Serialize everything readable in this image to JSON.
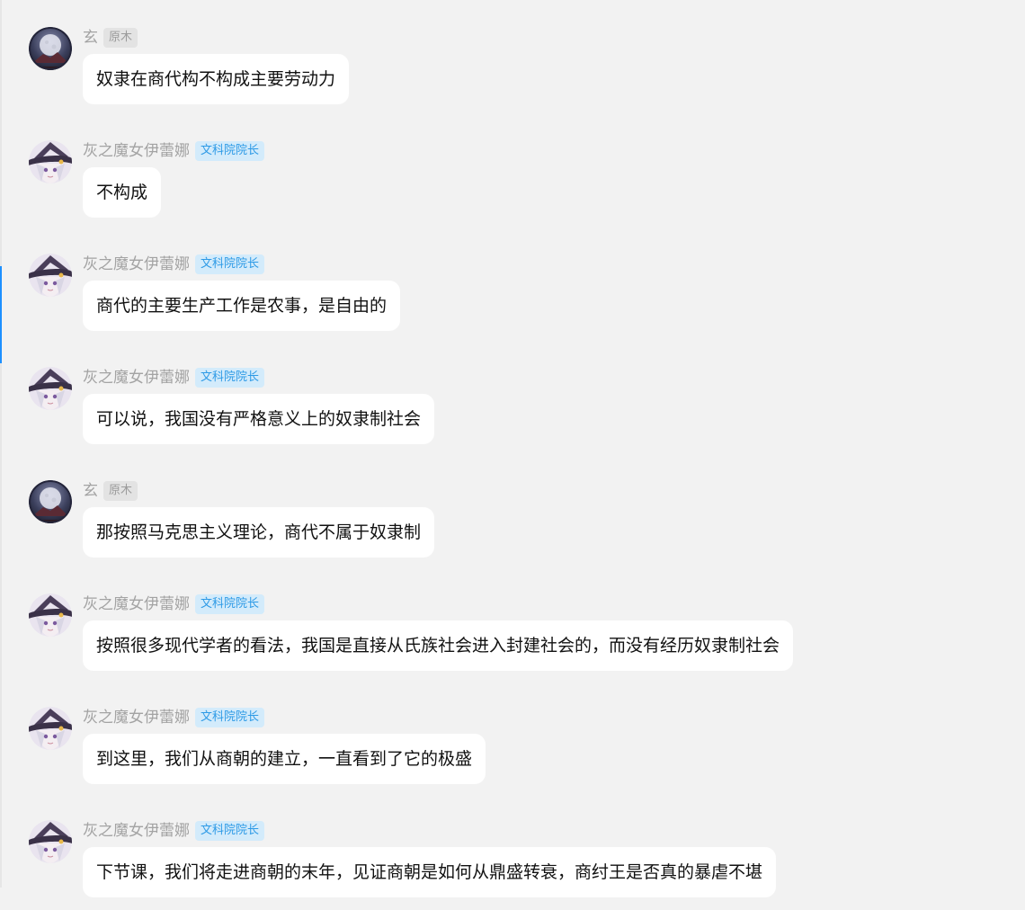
{
  "messages": [
    {
      "sender": "玄",
      "badge": "原木",
      "badge_style": "grey",
      "avatar": "xuan-avatar",
      "text": "奴隶在商代构不构成主要劳动力"
    },
    {
      "sender": "灰之魔女伊蕾娜",
      "badge": "文科院院长",
      "badge_style": "blue",
      "avatar": "elaina-avatar",
      "text": "不构成"
    },
    {
      "sender": "灰之魔女伊蕾娜",
      "badge": "文科院院长",
      "badge_style": "blue",
      "avatar": "elaina-avatar",
      "text": "商代的主要生产工作是农事，是自由的"
    },
    {
      "sender": "灰之魔女伊蕾娜",
      "badge": "文科院院长",
      "badge_style": "blue",
      "avatar": "elaina-avatar",
      "text": "可以说，我国没有严格意义上的奴隶制社会"
    },
    {
      "sender": "玄",
      "badge": "原木",
      "badge_style": "grey",
      "avatar": "xuan-avatar",
      "text": "那按照马克思主义理论，商代不属于奴隶制"
    },
    {
      "sender": "灰之魔女伊蕾娜",
      "badge": "文科院院长",
      "badge_style": "blue",
      "avatar": "elaina-avatar",
      "text": "按照很多现代学者的看法，我国是直接从氏族社会进入封建社会的，而没有经历奴隶制社会"
    },
    {
      "sender": "灰之魔女伊蕾娜",
      "badge": "文科院院长",
      "badge_style": "blue",
      "avatar": "elaina-avatar",
      "text": "到这里，我们从商朝的建立，一直看到了它的极盛"
    },
    {
      "sender": "灰之魔女伊蕾娜",
      "badge": "文科院院长",
      "badge_style": "blue",
      "avatar": "elaina-avatar",
      "text": "下节课，我们将走进商朝的末年，见证商朝是如何从鼎盛转衰，商纣王是否真的暴虐不堪"
    }
  ],
  "colors": {
    "background": "#f2f2f2",
    "bubble": "#ffffff",
    "sender_name": "#a3a3a3",
    "badge_blue_bg": "#d3ebfb",
    "badge_blue_text": "#2d9ae6",
    "badge_grey_bg": "#e3e3e3",
    "badge_grey_text": "#9b9b9b",
    "scroll_indicator": "#1e90ff"
  }
}
